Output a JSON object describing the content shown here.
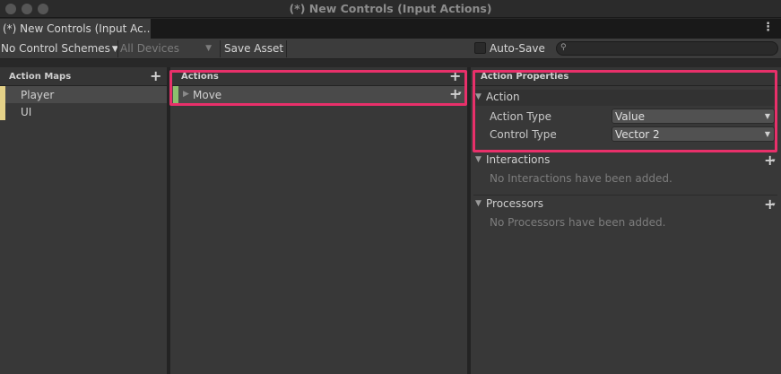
{
  "window": {
    "title": "(*) New Controls (Input Actions)"
  },
  "tab": {
    "label": "(*) New Controls (Input Ac..."
  },
  "toolbar": {
    "control_schemes": "No Control Schemes",
    "devices": "All Devices",
    "save_asset": "Save Asset",
    "auto_save_label": "Auto-Save",
    "auto_save_checked": false,
    "search_placeholder": ""
  },
  "action_maps": {
    "header": "Action Maps",
    "items": [
      {
        "label": "Player",
        "selected": true
      },
      {
        "label": "UI",
        "selected": false
      }
    ]
  },
  "actions": {
    "header": "Actions",
    "items": [
      {
        "label": "Move"
      }
    ]
  },
  "action_properties": {
    "header": "Action Properties",
    "action_section": {
      "title": "Action",
      "action_type_label": "Action Type",
      "action_type_value": "Value",
      "control_type_label": "Control Type",
      "control_type_value": "Vector 2"
    },
    "interactions": {
      "title": "Interactions",
      "empty": "No Interactions have been added."
    },
    "processors": {
      "title": "Processors",
      "empty": "No Processors have been added."
    }
  },
  "colors": {
    "highlight": "#e8306a",
    "action_map_marker": "#e5d288",
    "action_marker": "#8cbf6e"
  }
}
